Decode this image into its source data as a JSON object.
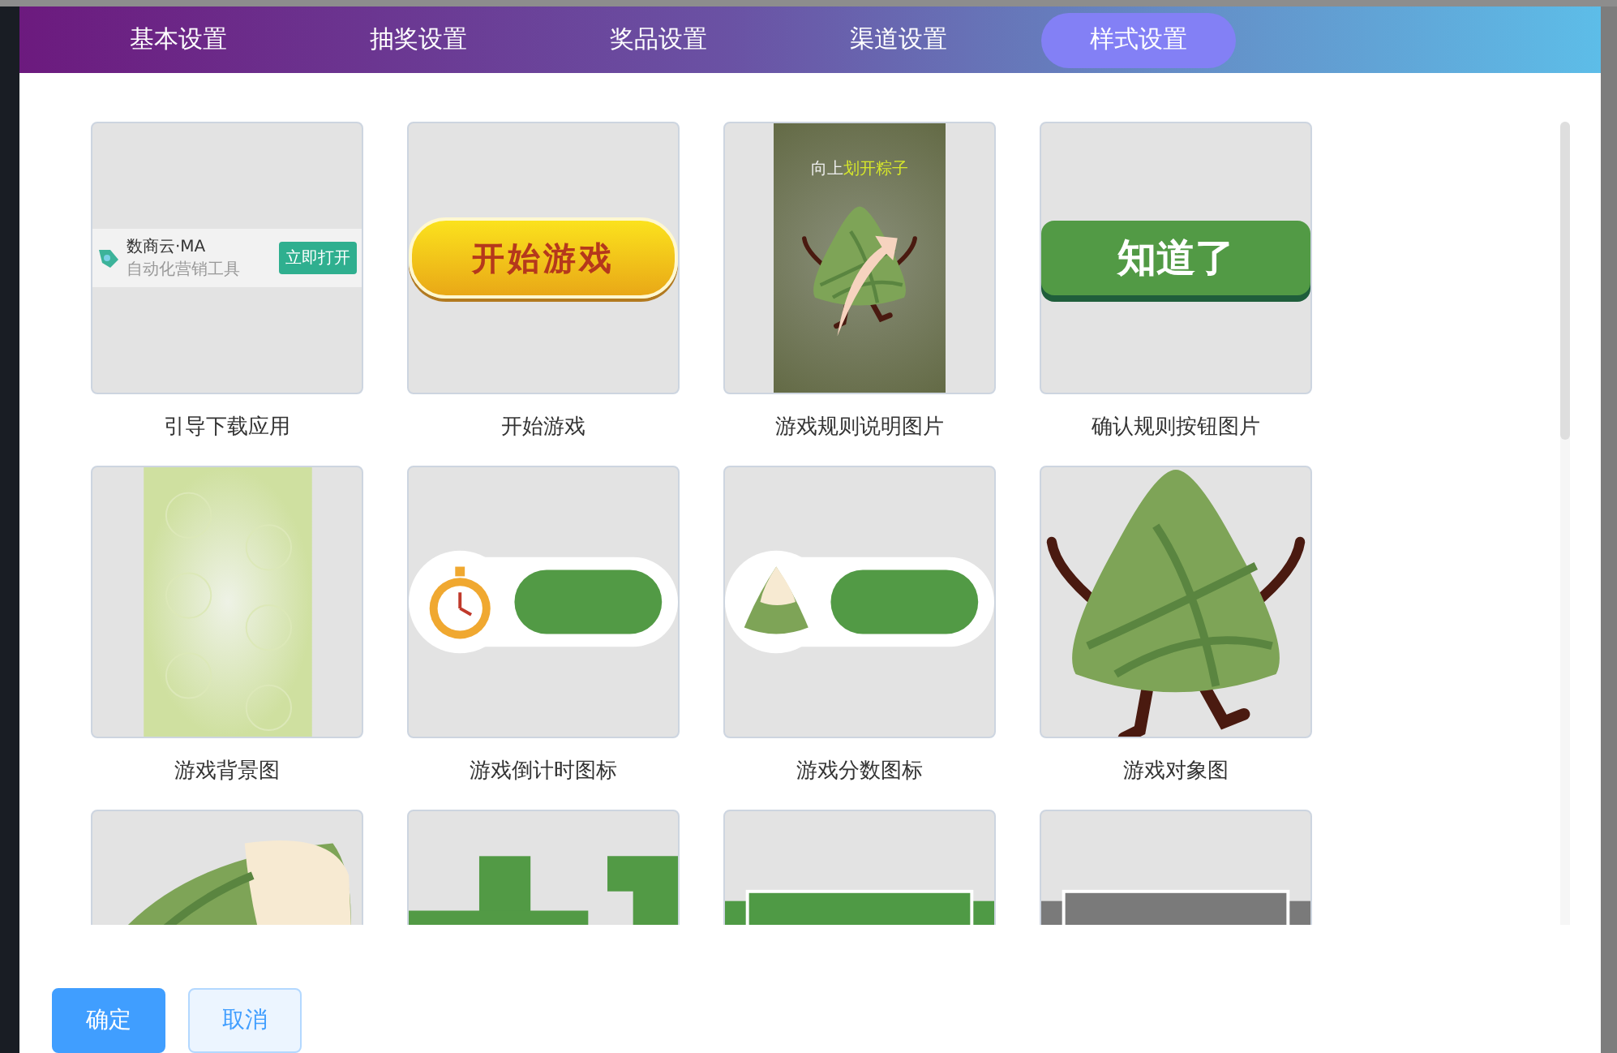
{
  "tabs": [
    {
      "label": "基本设置",
      "selected": false
    },
    {
      "label": "抽奖设置",
      "selected": false
    },
    {
      "label": "奖品设置",
      "selected": false
    },
    {
      "label": "渠道设置",
      "selected": false
    },
    {
      "label": "样式设置",
      "selected": true
    }
  ],
  "tiles": [
    {
      "kind": "app_banner",
      "caption": "引导下载应用",
      "app_name": "数商云·MA",
      "slogan": "自动化营销工具",
      "button": "立即打开"
    },
    {
      "kind": "yellow_button",
      "caption": "开始游戏",
      "text": "开始游戏"
    },
    {
      "kind": "poster",
      "caption": "游戏规则说明图片",
      "hint": [
        {
          "text": "向上",
          "highlight": false
        },
        {
          "text": "划开粽子",
          "highlight": true
        }
      ]
    },
    {
      "kind": "green_button",
      "caption": "确认规则按钮图片",
      "text": "知道了"
    },
    {
      "kind": "texture",
      "caption": "游戏背景图"
    },
    {
      "kind": "timer_bar",
      "caption": "游戏倒计时图标"
    },
    {
      "kind": "score_bar",
      "caption": "游戏分数图标"
    },
    {
      "kind": "character",
      "caption": "游戏对象图"
    },
    {
      "kind": "closeup"
    },
    {
      "kind": "plus_one"
    },
    {
      "kind": "ribbon",
      "color": "#4f9a45"
    },
    {
      "kind": "ribbon",
      "color": "#7a7a7a"
    }
  ],
  "buttons": [
    {
      "label": "确定",
      "kind": "primary"
    },
    {
      "label": "取消",
      "kind": "secondary"
    }
  ]
}
